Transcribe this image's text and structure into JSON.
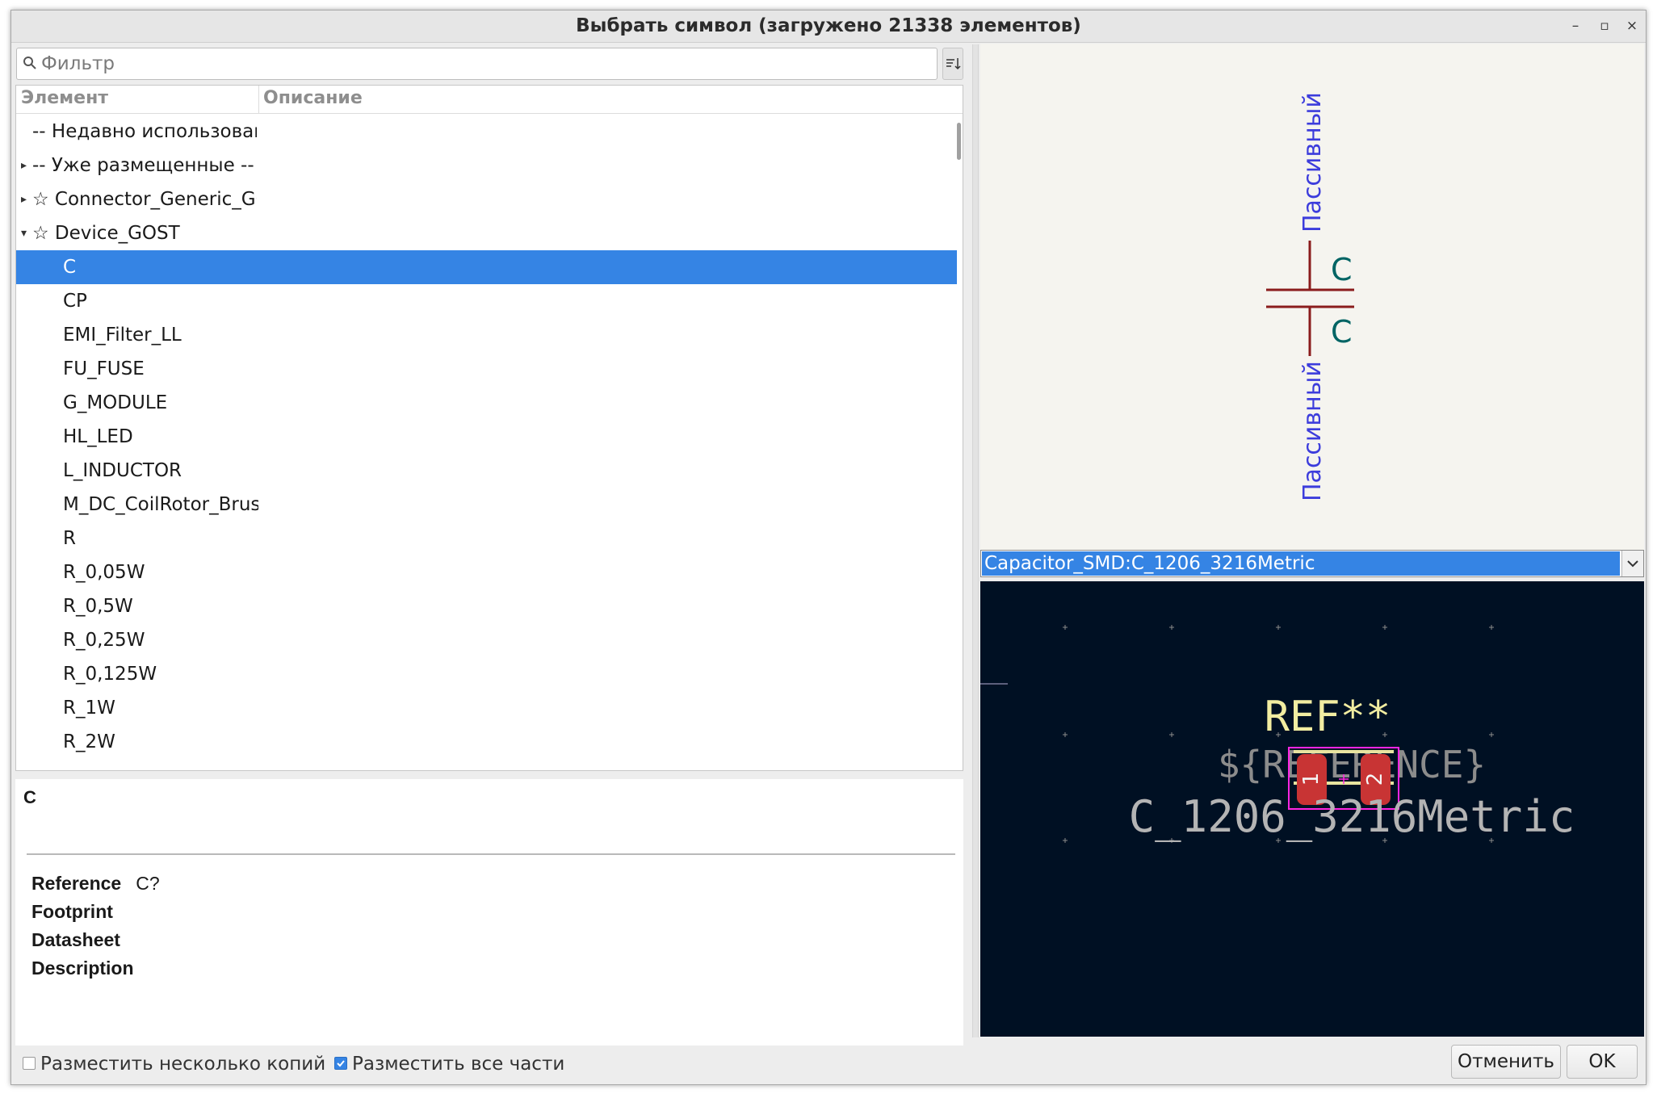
{
  "window": {
    "title": "Выбрать символ (загружено 21338 элементов)",
    "controls": {
      "minimize": "–",
      "maximize": "▫",
      "close": "×"
    }
  },
  "filter": {
    "placeholder": "Фильтр",
    "value": ""
  },
  "tree": {
    "columns": [
      "Элемент",
      "Описание"
    ],
    "rows": [
      {
        "label": "-- Недавно использовани",
        "indent": 0,
        "arrow": "",
        "selected": false
      },
      {
        "label": "-- Уже размещенные --",
        "indent": 0,
        "arrow": "right",
        "selected": false
      },
      {
        "label": "☆ Connector_Generic_GC",
        "indent": 0,
        "arrow": "right",
        "selected": false
      },
      {
        "label": "☆ Device_GOST",
        "indent": 0,
        "arrow": "down",
        "selected": false
      },
      {
        "label": "C",
        "indent": 1,
        "arrow": "",
        "selected": true
      },
      {
        "label": "CP",
        "indent": 1,
        "arrow": "",
        "selected": false
      },
      {
        "label": "EMI_Filter_LL",
        "indent": 1,
        "arrow": "",
        "selected": false
      },
      {
        "label": "FU_FUSE",
        "indent": 1,
        "arrow": "",
        "selected": false
      },
      {
        "label": "G_MODULE",
        "indent": 1,
        "arrow": "",
        "selected": false
      },
      {
        "label": "HL_LED",
        "indent": 1,
        "arrow": "",
        "selected": false
      },
      {
        "label": "L_INDUCTOR",
        "indent": 1,
        "arrow": "",
        "selected": false
      },
      {
        "label": "M_DC_CoilRotor_Brusl",
        "indent": 1,
        "arrow": "",
        "selected": false
      },
      {
        "label": "R",
        "indent": 1,
        "arrow": "",
        "selected": false
      },
      {
        "label": "R_0,05W",
        "indent": 1,
        "arrow": "",
        "selected": false
      },
      {
        "label": "R_0,5W",
        "indent": 1,
        "arrow": "",
        "selected": false
      },
      {
        "label": "R_0,25W",
        "indent": 1,
        "arrow": "",
        "selected": false
      },
      {
        "label": "R_0,125W",
        "indent": 1,
        "arrow": "",
        "selected": false
      },
      {
        "label": "R_1W",
        "indent": 1,
        "arrow": "",
        "selected": false
      },
      {
        "label": "R_2W",
        "indent": 1,
        "arrow": "",
        "selected": false
      }
    ]
  },
  "details": {
    "name": "C",
    "fields": [
      {
        "label": "Reference",
        "value": "C?"
      },
      {
        "label": "Footprint",
        "value": ""
      },
      {
        "label": "Datasheet",
        "value": ""
      },
      {
        "label": "Description",
        "value": ""
      }
    ]
  },
  "bottom": {
    "multi_copies": {
      "label": "Разместить несколько копий",
      "checked": false
    },
    "all_units": {
      "label": "Разместить все части",
      "checked": true
    },
    "cancel_label": "Отменить",
    "ok_label": "OK"
  },
  "symbol_preview": {
    "pin_type_top": "Пассивный",
    "pin_type_bottom": "Пассивный",
    "pin_name_top": "C",
    "pin_name_bottom": "C",
    "colors": {
      "body": "#8a1c1c",
      "pin_name": "#006464",
      "pin_type": "#3c3cdc"
    }
  },
  "footprint": {
    "selected": "Capacitor_SMD:C_1206_3216Metric",
    "ref_text": "REF**",
    "ref_value_text": "${REFERENCE}",
    "value_text": "C_1206_3216Metric",
    "pad_1": "1",
    "pad_2": "2",
    "colors": {
      "background": "#001023",
      "ref": "#f2eda1",
      "value": "#b4b4b4",
      "pad": "#c83434",
      "courtyard": "#ff26e2"
    }
  }
}
